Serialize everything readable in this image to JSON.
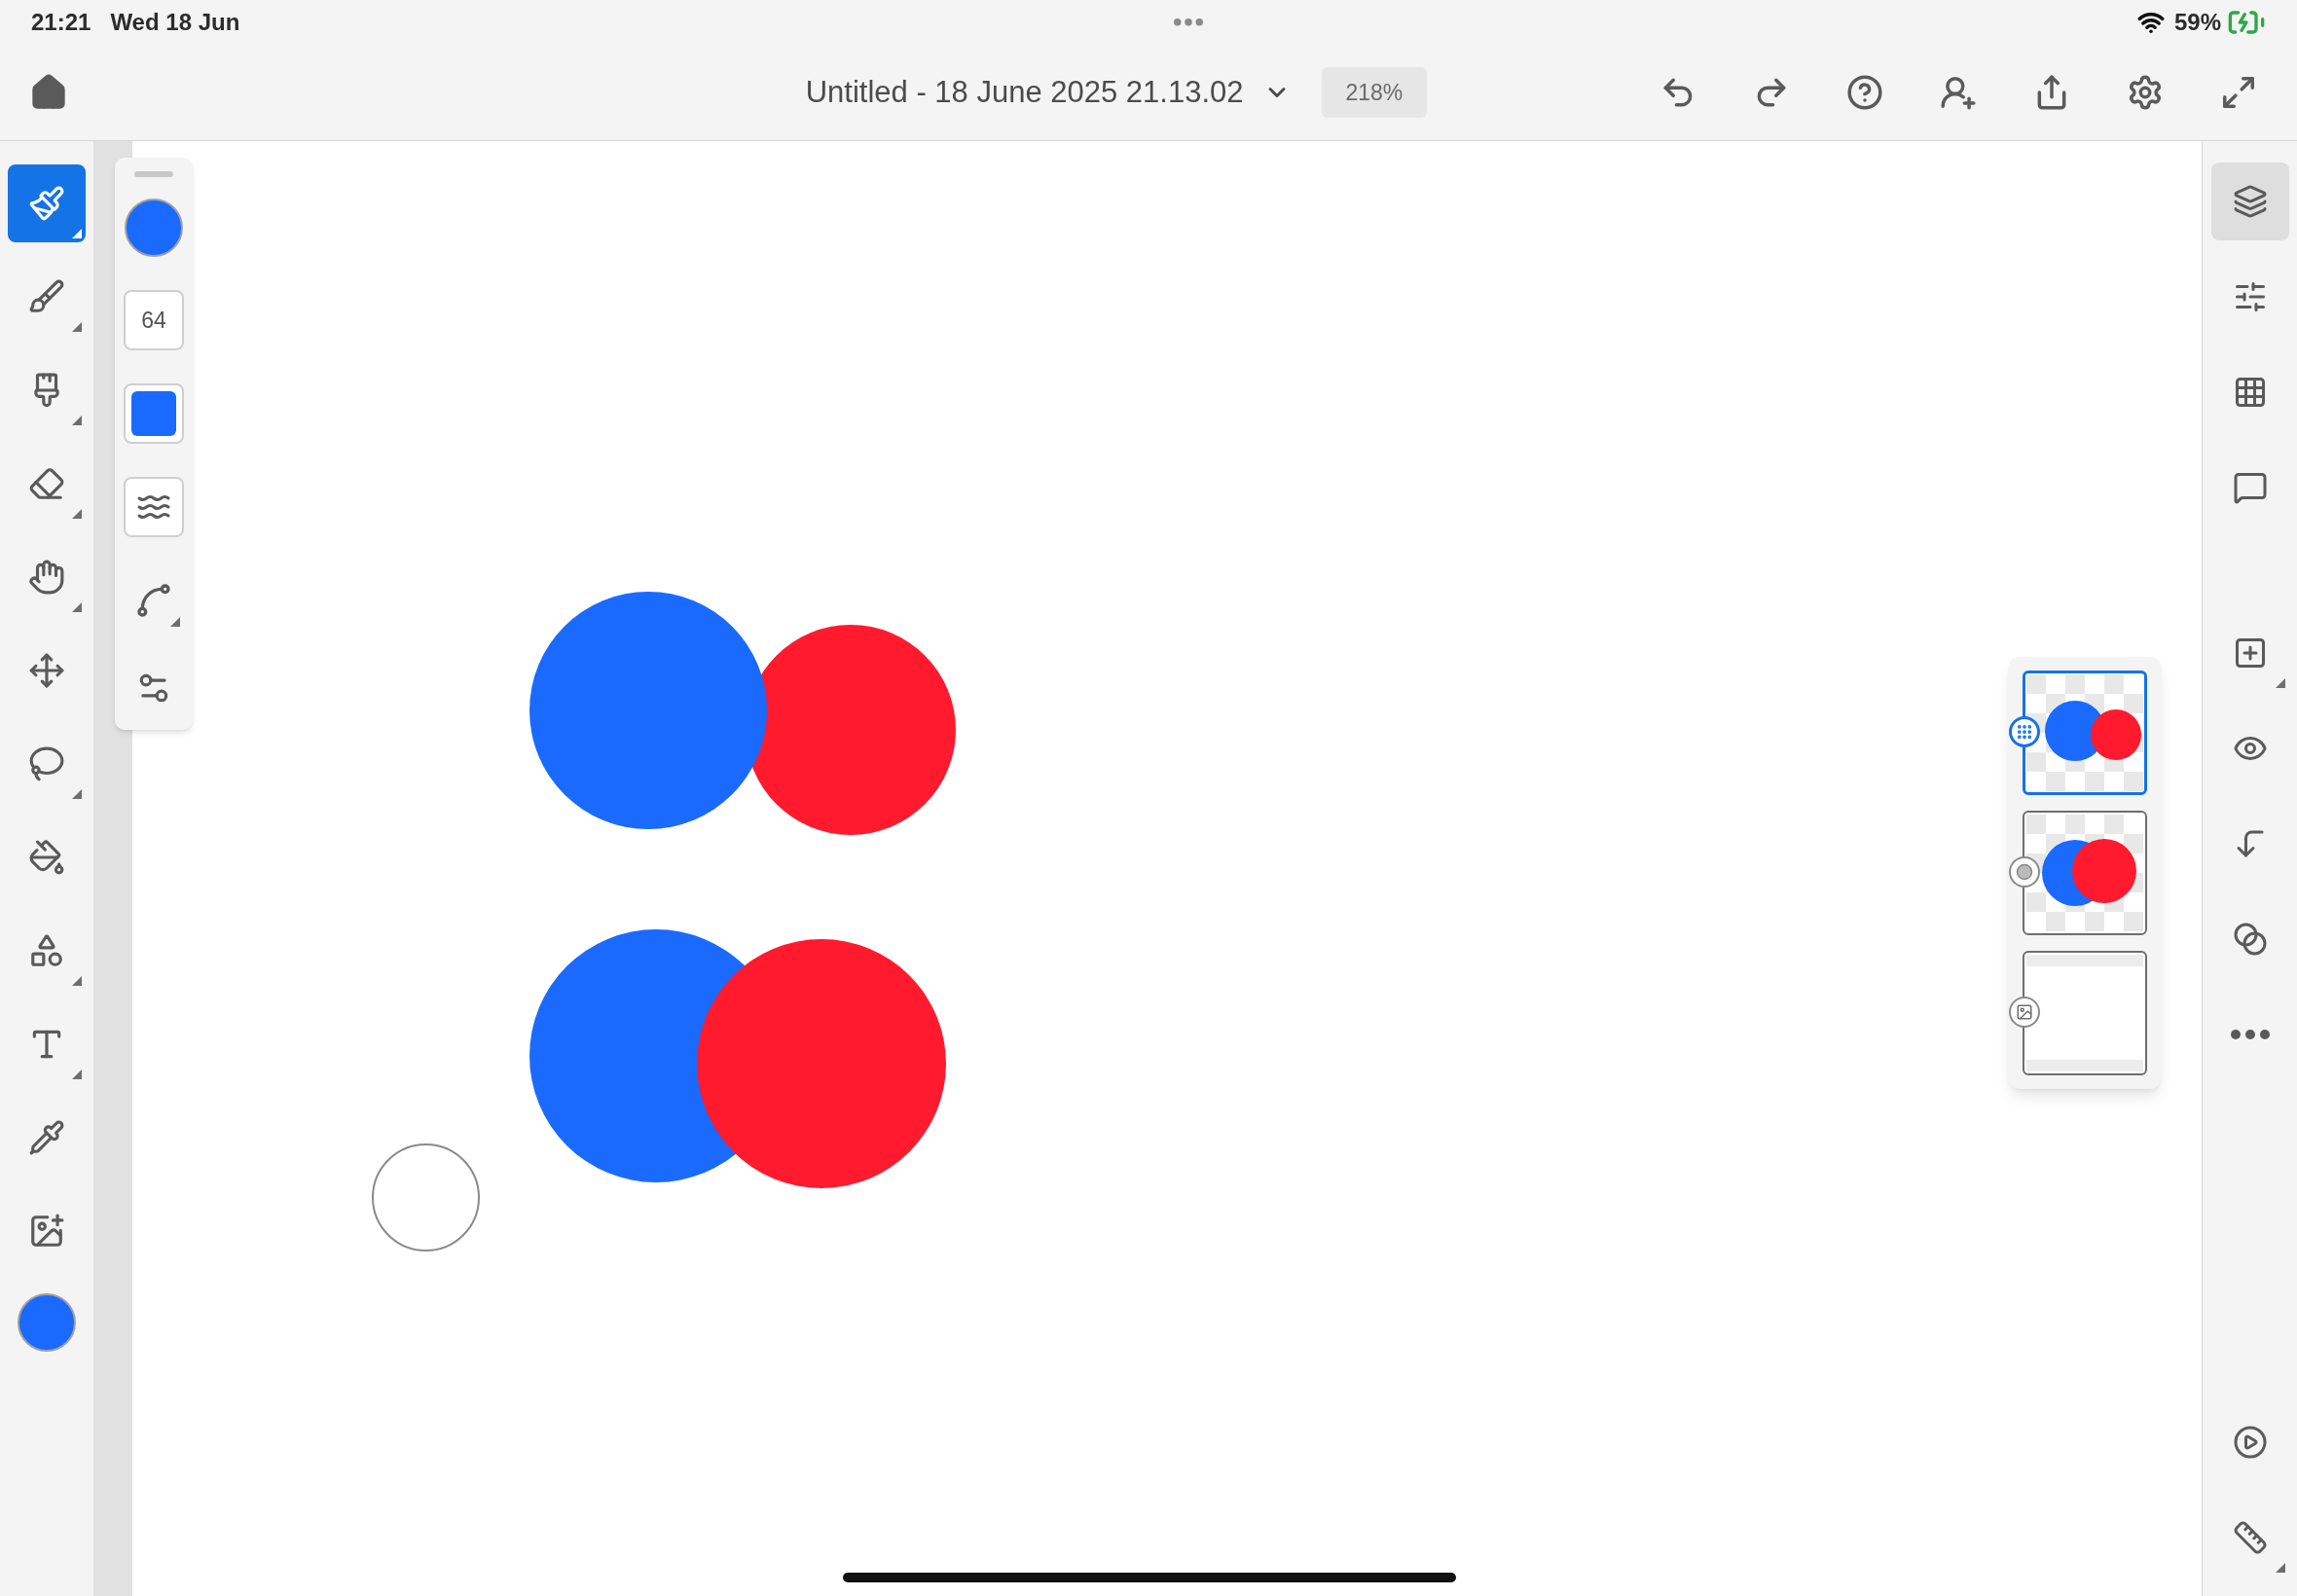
{
  "status_bar": {
    "time": "21:21",
    "date": "Wed 18 Jun",
    "battery": "59%"
  },
  "top_bar": {
    "title": "Untitled - 18 June 2025 21.13.02",
    "zoom": "218%"
  },
  "tools": [
    {
      "kind": "pixel-brush",
      "selected": true,
      "submenu": true
    },
    {
      "kind": "watercolor-brush",
      "selected": false,
      "submenu": true
    },
    {
      "kind": "live-brush",
      "selected": false,
      "submenu": true
    },
    {
      "kind": "eraser",
      "selected": false,
      "submenu": true
    },
    {
      "kind": "smudge",
      "selected": false,
      "submenu": true
    },
    {
      "kind": "move",
      "selected": false,
      "submenu": false
    },
    {
      "kind": "lasso",
      "selected": false,
      "submenu": true
    },
    {
      "kind": "fill",
      "selected": false,
      "submenu": false
    },
    {
      "kind": "shapes",
      "selected": false,
      "submenu": true
    },
    {
      "kind": "text",
      "selected": false,
      "submenu": true
    },
    {
      "kind": "eyedropper",
      "selected": false,
      "submenu": false
    },
    {
      "kind": "place-image",
      "selected": false,
      "submenu": false
    }
  ],
  "current_color": {
    "color": "#1a6aff"
  },
  "brush_options": {
    "color": "#1a6aff",
    "size": "64"
  },
  "layers": [
    {
      "kind": "pixel",
      "selected": true
    },
    {
      "kind": "vector",
      "selected": false
    },
    {
      "kind": "background",
      "selected": false
    }
  ],
  "right_toolbar": {
    "top": [
      {
        "kind": "layers",
        "selected": true,
        "submenu": false
      },
      {
        "kind": "properties",
        "selected": false,
        "submenu": false
      },
      {
        "kind": "grid",
        "selected": false,
        "submenu": false
      },
      {
        "kind": "comments",
        "selected": false,
        "submenu": false
      }
    ],
    "middle": [
      {
        "kind": "add-layer",
        "selected": false,
        "submenu": true
      },
      {
        "kind": "visibility",
        "selected": false,
        "submenu": false
      },
      {
        "kind": "merge-down",
        "selected": false,
        "submenu": false
      },
      {
        "kind": "blend",
        "selected": false,
        "submenu": false
      },
      {
        "kind": "more",
        "selected": false,
        "submenu": false
      }
    ],
    "bottom": [
      {
        "kind": "timelapse",
        "selected": false,
        "submenu": false
      },
      {
        "kind": "ruler",
        "selected": false,
        "submenu": true
      }
    ]
  }
}
